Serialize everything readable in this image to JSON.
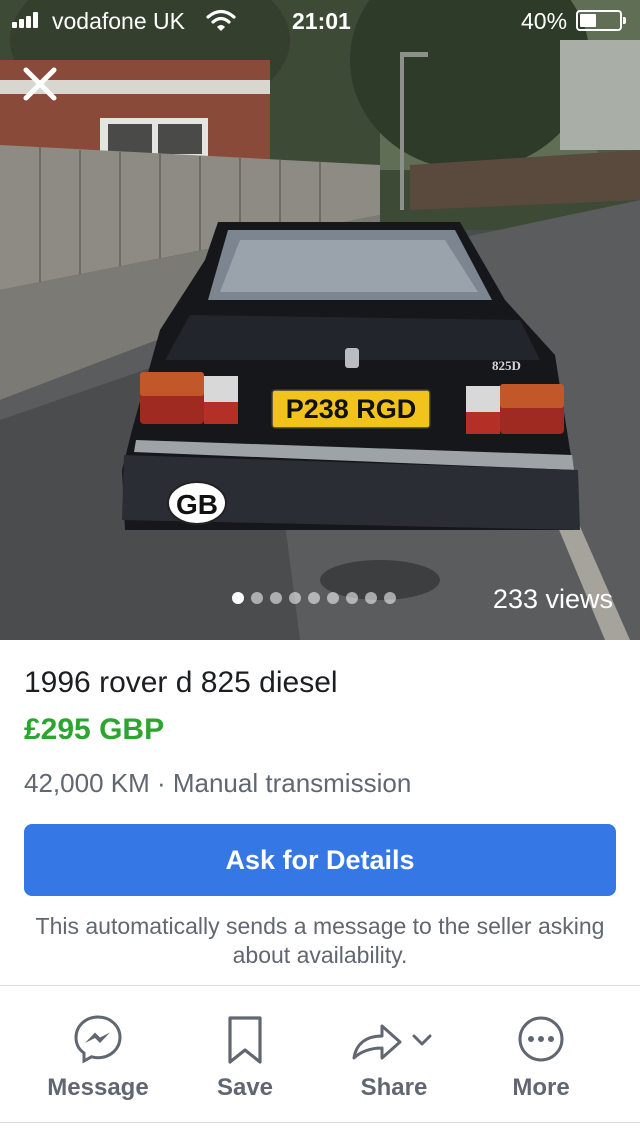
{
  "status_bar": {
    "carrier": "vodafone UK",
    "time": "21:01",
    "battery": "40%"
  },
  "photo": {
    "plate_text": "P238 RGD",
    "badge_text": "GB",
    "model_badge": "825D",
    "views": "233 views",
    "page_count": 9,
    "active_page": 0
  },
  "listing": {
    "title": "1996 rover d 825 diesel",
    "price": "£295 GBP",
    "meta": "42,000 KM · Manual transmission"
  },
  "ask": {
    "button_label": "Ask for Details",
    "note": "This automatically sends a message to the seller asking about availability."
  },
  "actions": {
    "message_label": "Message",
    "save_label": "Save",
    "share_label": "Share",
    "more_label": "More"
  },
  "icons": {
    "close": "close-icon",
    "message": "messenger-icon",
    "save": "bookmark-icon",
    "share": "share-arrow-icon",
    "more": "more-dots-icon"
  },
  "colors": {
    "accent_button": "#3578e5",
    "price_green": "#2ba52f",
    "secondary_text": "#606770"
  }
}
